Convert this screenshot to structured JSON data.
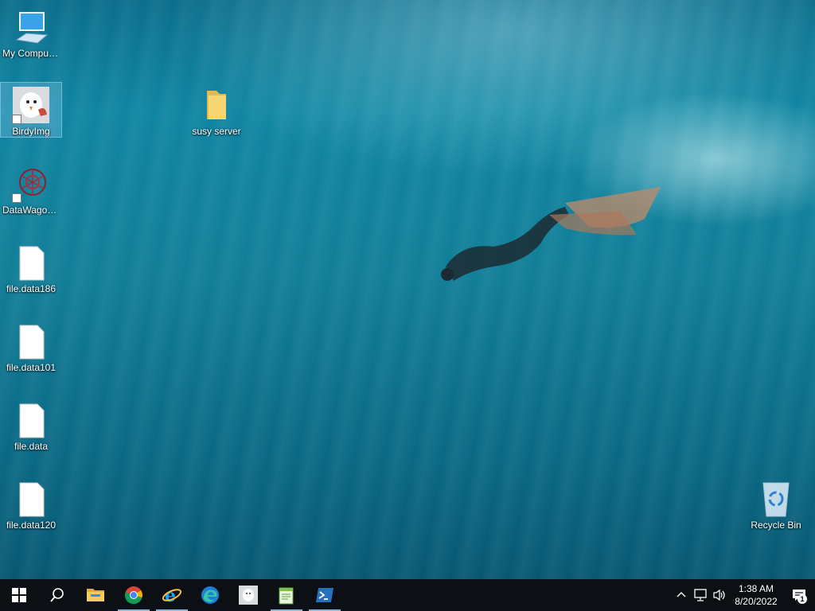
{
  "desktop": {
    "icons": [
      {
        "label": "My Computer",
        "type": "computer"
      },
      {
        "label": "BirdyImg",
        "type": "shortcut-image"
      },
      {
        "label": "DataWagon...",
        "type": "shortcut-app"
      },
      {
        "label": "file.data186",
        "type": "file"
      },
      {
        "label": "file.data101",
        "type": "file"
      },
      {
        "label": "file.data",
        "type": "file"
      },
      {
        "label": "file.data120",
        "type": "file"
      },
      {
        "label": "susy server",
        "type": "folder"
      },
      {
        "label": "Recycle Bin",
        "type": "recycle-bin"
      }
    ],
    "selected_icon": "BirdyImg"
  },
  "taskbar": {
    "items": [
      {
        "name": "start-button",
        "icon": "windows-logo-icon"
      },
      {
        "name": "search-button",
        "icon": "search-icon"
      },
      {
        "name": "file-explorer",
        "icon": "folder-icon"
      },
      {
        "name": "chrome",
        "icon": "chrome-icon",
        "active": true
      },
      {
        "name": "internet-explorer",
        "icon": "ie-icon",
        "active": true
      },
      {
        "name": "edge",
        "icon": "edge-icon"
      },
      {
        "name": "birdyimg-app",
        "icon": "bird-image-icon"
      },
      {
        "name": "notepad-app",
        "icon": "notepad-icon",
        "active": true
      },
      {
        "name": "powershell",
        "icon": "powershell-icon",
        "active": true
      }
    ],
    "tray": {
      "time": "1:38 AM",
      "date": "8/20/2022",
      "notification_count": "1"
    }
  },
  "colors": {
    "taskbar_bg": "#0c0f14",
    "accent": "#8ab4d8",
    "water": "#0f86a2"
  }
}
